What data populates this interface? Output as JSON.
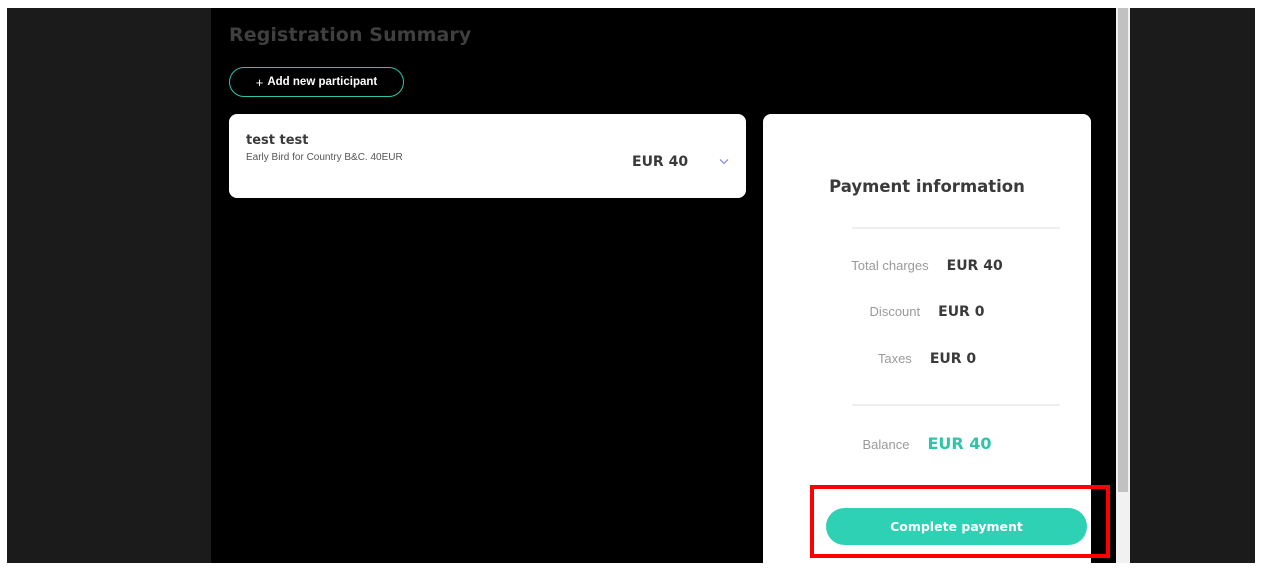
{
  "header": {
    "title": "Registration Summary"
  },
  "actions": {
    "add_participant_label": "Add new participant",
    "add_participant_icon": "+"
  },
  "participants": [
    {
      "name": "test test",
      "ticket": "Early Bird for Country B&C. 40EUR",
      "price": "EUR 40",
      "expand_icon": "chevron-down-icon"
    }
  ],
  "payment": {
    "title": "Payment information",
    "rows": [
      {
        "label": "Total charges",
        "value": "EUR 40"
      },
      {
        "label": "Discount",
        "value": "EUR 0"
      },
      {
        "label": "Taxes",
        "value": "EUR 0"
      }
    ],
    "balance": {
      "label": "Balance",
      "value": "EUR 40"
    },
    "complete_label": "Complete payment"
  },
  "colors": {
    "accent": "#2ec4a8",
    "button": "#2fd1b5",
    "highlight": "#ff0000",
    "panel_bg": "#000000"
  }
}
